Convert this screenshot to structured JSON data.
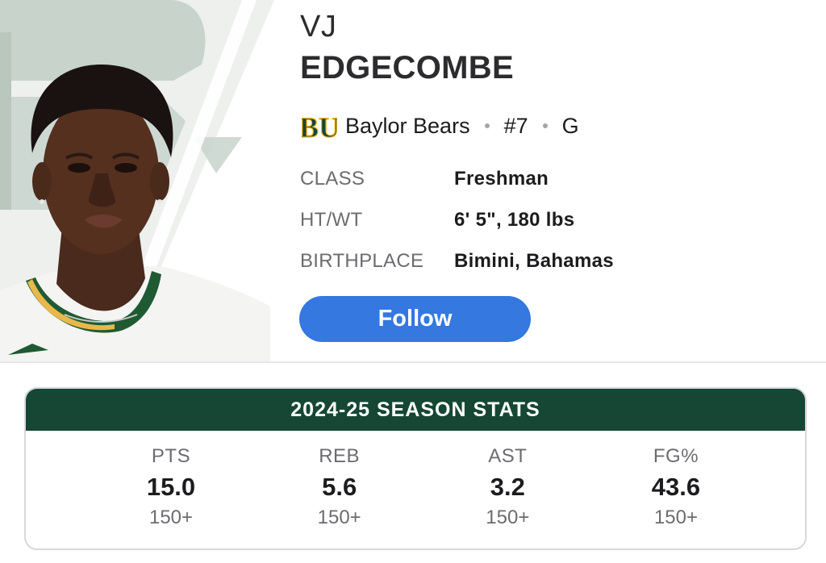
{
  "player": {
    "first_name": "VJ",
    "last_name": "EDGECOMBE",
    "team": "Baylor Bears",
    "number": "#7",
    "position": "G",
    "team_logo_text": "BU"
  },
  "bio": [
    {
      "label": "CLASS",
      "value": "Freshman"
    },
    {
      "label": "HT/WT",
      "value": "6' 5\", 180 lbs"
    },
    {
      "label": "BIRTHPLACE",
      "value": "Bimini, Bahamas"
    }
  ],
  "follow_label": "Follow",
  "stats": {
    "title": "2024-25 SEASON STATS",
    "items": [
      {
        "label": "PTS",
        "value": "15.0",
        "rank": "150+"
      },
      {
        "label": "REB",
        "value": "5.6",
        "rank": "150+"
      },
      {
        "label": "AST",
        "value": "3.2",
        "rank": "150+"
      },
      {
        "label": "FG%",
        "value": "43.6",
        "rank": "150+"
      }
    ]
  },
  "colors": {
    "team_green": "#154734",
    "team_gold": "#FFB81C",
    "follow_blue": "#3478E0"
  }
}
